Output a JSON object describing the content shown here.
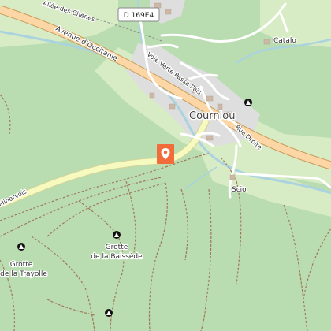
{
  "map": {
    "colors": {
      "forest": "#b9dcb0",
      "meadow": "#d7ecc4",
      "urban": "#dedede",
      "water": "#aad3df",
      "primary_road": "#fcd6a4",
      "primary_casing": "#c99c5c",
      "secondary_road": "#f7fabf",
      "path": "#a0785a",
      "marker": "#f26b3a",
      "cave": "#111111"
    },
    "road_ref": "D 169E4",
    "streets": {
      "avenue_occitanie": "Avenue d'Occitanie",
      "allee_chenes": "Allée des Chênes",
      "voie_verte": "Voie Verte Passa Païs",
      "rue_droite": "Rue Droite",
      "minervois": "Minervois"
    },
    "places": {
      "courniou": "Courniou",
      "catalo": "Catalo",
      "scio": "Scio"
    },
    "caves": {
      "baissede_line1": "Grotte",
      "baissede_line2": "de la Baissède",
      "trayolle_line1": "Grotte",
      "trayolle_line2": "de la Trayolle"
    },
    "marker_icon": "map-pin-icon"
  }
}
